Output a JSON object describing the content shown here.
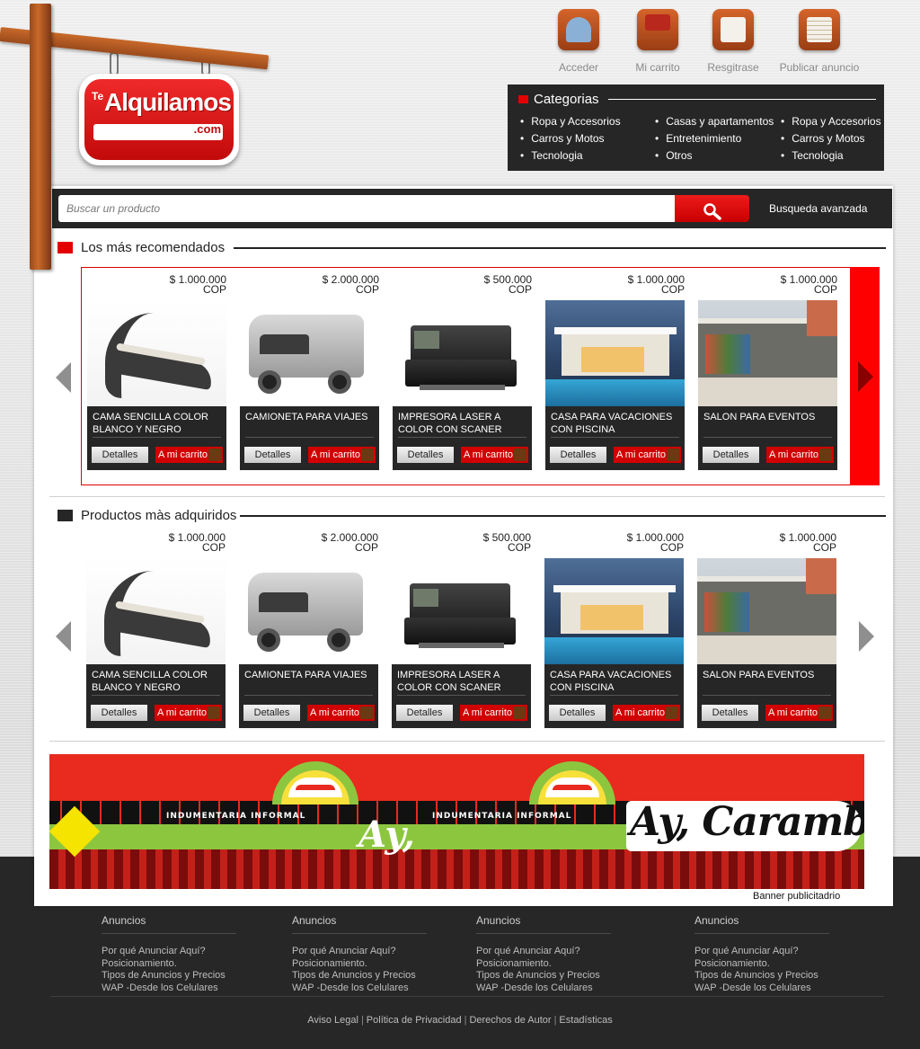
{
  "logo": {
    "prefix": "Te",
    "main": "Alquilamos",
    "suffix": ".com"
  },
  "nav": [
    {
      "label": "Acceder",
      "icon": "user-icon"
    },
    {
      "label": "Mi carrito",
      "icon": "cart-icon"
    },
    {
      "label": "Resgitrase",
      "icon": "clipboard-icon"
    },
    {
      "label": "Publicar anuncio",
      "icon": "folder-icon"
    }
  ],
  "categories": {
    "title": "Categorias",
    "columns": [
      [
        "Ropa y Accesorios",
        "Carros y Motos",
        "Tecnologia"
      ],
      [
        "Casas y apartamentos",
        "Entretenimiento",
        "Otros"
      ],
      [
        "Ropa y Accesorios",
        "Carros y Motos",
        "Tecnologia"
      ]
    ]
  },
  "search": {
    "placeholder": "Buscar un producto",
    "advanced": "Busqueda avanzada"
  },
  "sections": {
    "recommended": "Los más recomendados",
    "acquired": "Productos màs adquiridos"
  },
  "buttons": {
    "details": "Detalles",
    "cart": "A mi carrito"
  },
  "products": [
    {
      "price": "$ 1.000.000",
      "currency": "COP",
      "name": "CAMA SENCILLA COLOR BLANCO Y NEGRO",
      "image": "chaise-lounge"
    },
    {
      "price": "$ 2.000.000",
      "currency": "COP",
      "name": "CAMIONETA PARA VIAJES",
      "image": "camper-van"
    },
    {
      "price": "$ 500.000",
      "currency": "COP",
      "name": "IMPRESORA LASER A COLOR CON SCANER",
      "image": "laser-printer"
    },
    {
      "price": "$ 1.000.000",
      "currency": "COP",
      "name": "CASA PARA VACACIONES CON PISCINA",
      "image": "house-pool"
    },
    {
      "price": "$ 1.000.000",
      "currency": "COP",
      "name": "SALON PARA EVENTOS",
      "image": "event-hall"
    }
  ],
  "banner": {
    "tagline": "INDUMENTARIA INFORMAL",
    "ay": "Ay,",
    "brand": "Ay, Caramba",
    "caption": "Banner publicitadrio"
  },
  "footer": {
    "columns": [
      {
        "title": "Anuncios",
        "links": [
          "Por qué Anunciar Aquí?",
          "Posicionamiento.",
          "Tipos de Anuncios y Precios",
          "WAP -Desde los Celulares"
        ]
      },
      {
        "title": "Anuncios",
        "links": [
          "Por qué Anunciar Aquí?",
          "Posicionamiento.",
          "Tipos de Anuncios y Precios",
          "WAP -Desde los Celulares"
        ]
      },
      {
        "title": "Anuncios",
        "links": [
          "Por qué Anunciar Aquí?",
          "Posicionamiento.",
          "Tipos de Anuncios y Precios",
          "WAP -Desde los Celulares"
        ]
      },
      {
        "title": "Anuncios",
        "links": [
          "Por qué Anunciar Aquí?",
          "Posicionamiento.",
          "Tipos de Anuncios y Precios",
          "WAP -Desde los Celulares"
        ]
      }
    ],
    "legal": [
      "Aviso Legal",
      "Política de Privacidad",
      "Derechos de Autor",
      "Estadísticas"
    ],
    "separator": "|"
  },
  "colors": {
    "accent": "#e50000",
    "dark": "#262626",
    "wood": "#b65a24"
  }
}
